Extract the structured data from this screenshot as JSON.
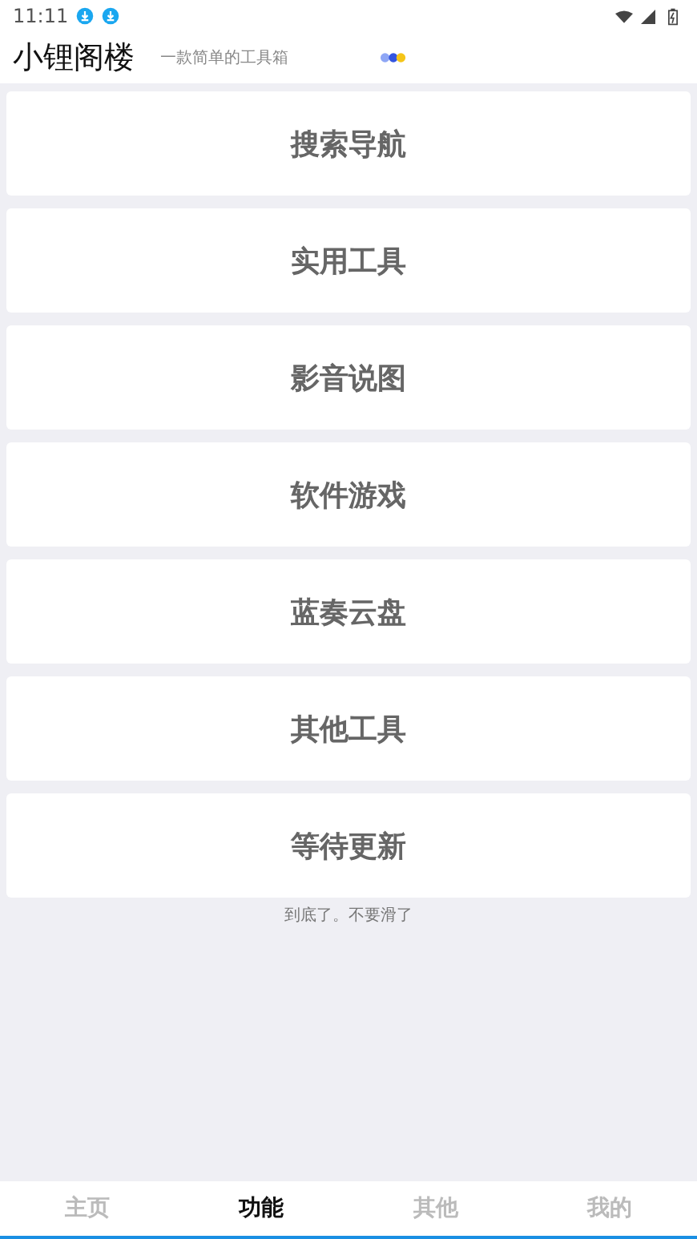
{
  "status_bar": {
    "time": "11:11"
  },
  "header": {
    "title": "小锂阁楼",
    "subtitle": "一款简单的工具箱"
  },
  "menu": [
    {
      "label": "搜索导航"
    },
    {
      "label": "实用工具"
    },
    {
      "label": "影音说图"
    },
    {
      "label": "软件游戏"
    },
    {
      "label": "蓝奏云盘"
    },
    {
      "label": "其他工具"
    },
    {
      "label": "等待更新"
    }
  ],
  "end_note": "到底了。不要滑了",
  "tabs": [
    {
      "label": "主页",
      "selected": false
    },
    {
      "label": "功能",
      "selected": true
    },
    {
      "label": "其他",
      "selected": false
    },
    {
      "label": "我的",
      "selected": false
    }
  ]
}
